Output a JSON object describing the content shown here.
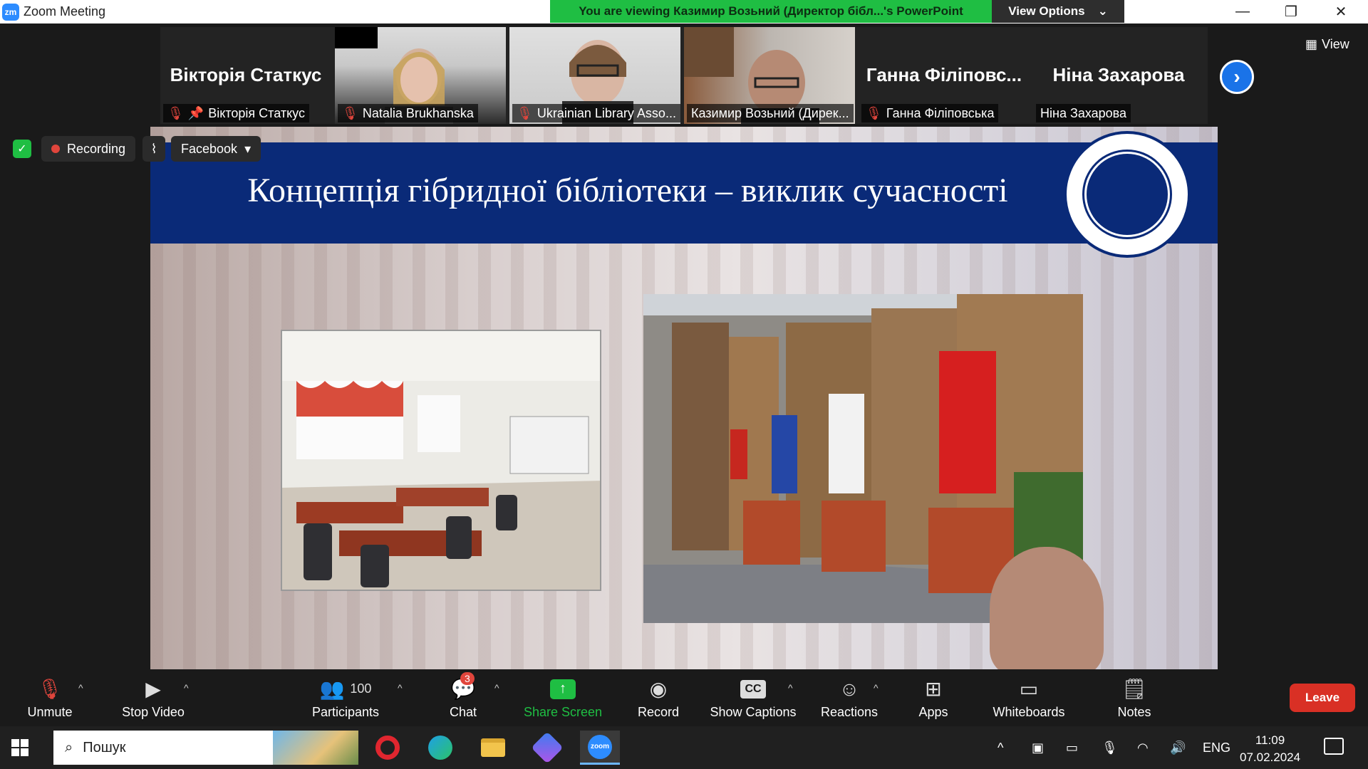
{
  "window": {
    "app_title": "Zoom Meeting",
    "share_banner": "You are viewing Казимир Возьний (Директор бібл...'s PowerPoint",
    "view_options": "View Options"
  },
  "gallery": {
    "participants": [
      {
        "name_big": "Вікторія Статкус",
        "label": "Вікторія Статкус",
        "muted": true,
        "pinned": true,
        "video": false
      },
      {
        "name_big": "",
        "label": "Natalia Brukhanska",
        "muted": true,
        "video": true
      },
      {
        "name_big": "",
        "label": "Ukrainian Library Asso...",
        "muted": true,
        "video": true
      },
      {
        "name_big": "",
        "label": "Казимир Возьний (Дирек...",
        "muted": false,
        "video": true,
        "active_speaker": true
      },
      {
        "name_big": "Ганна Філіповс...",
        "label": "Ганна Філіповська",
        "muted": true,
        "video": false
      },
      {
        "name_big": "Ніна Захарова",
        "label": "Ніна Захарова",
        "muted": false,
        "video": false
      }
    ],
    "view_label": "View"
  },
  "status": {
    "recording_label": "Recording",
    "stream_label": "Facebook"
  },
  "slide": {
    "title": "Концепція гібридної бібліотеки – виклик сучасності",
    "header_color": "#0a2a78"
  },
  "toolbar": {
    "unmute": "Unmute",
    "stop_video": "Stop Video",
    "participants": "Participants",
    "participants_count": "100",
    "chat": "Chat",
    "chat_badge": "3",
    "share_screen": "Share Screen",
    "record": "Record",
    "show_captions": "Show Captions",
    "reactions": "Reactions",
    "apps": "Apps",
    "whiteboards": "Whiteboards",
    "notes": "Notes",
    "leave": "Leave"
  },
  "taskbar": {
    "search_placeholder": "Пошук",
    "language": "ENG",
    "time": "11:09",
    "date": "07.02.2024"
  },
  "colors": {
    "zoom_blue": "#2d8cff",
    "share_green": "#1fbe43",
    "leave_red": "#d93025"
  }
}
